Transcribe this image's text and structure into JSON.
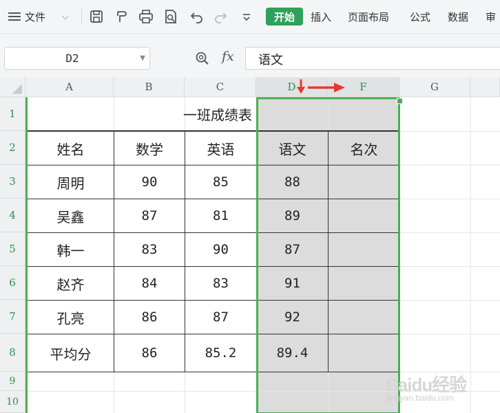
{
  "toolbar": {
    "file_menu_label": "文件",
    "tab_start": "开始",
    "tab_insert": "插入",
    "tab_page_layout": "页面布局",
    "tab_formulas": "公式",
    "tab_data": "数据",
    "tab_review_partial": "审"
  },
  "formula_bar": {
    "name_box": "D2",
    "fx_label": "fx",
    "content": "语文"
  },
  "columns": [
    "A",
    "B",
    "C",
    "D",
    "F",
    "G"
  ],
  "rows": [
    "1",
    "2",
    "3",
    "4",
    "5",
    "6",
    "7",
    "8",
    "9",
    "10"
  ],
  "sheet": {
    "title": "一班成绩表",
    "headers": [
      "姓名",
      "数学",
      "英语",
      "语文",
      "名次"
    ],
    "data": [
      [
        "周明",
        "90",
        "85",
        "88",
        ""
      ],
      [
        "吴鑫",
        "87",
        "81",
        "89",
        ""
      ],
      [
        "韩一",
        "83",
        "90",
        "87",
        ""
      ],
      [
        "赵齐",
        "84",
        "83",
        "91",
        ""
      ],
      [
        "孔亮",
        "86",
        "87",
        "92",
        ""
      ],
      [
        "平均分",
        "86",
        "85.2",
        "89.4",
        ""
      ]
    ]
  },
  "selection": {
    "range": "D:F",
    "accent_color": "#4caf50"
  },
  "annotation": {
    "arrow_color": "#e53935"
  },
  "watermark": {
    "main": "Baidu经验",
    "sub": "jingyan.baidu.com"
  }
}
